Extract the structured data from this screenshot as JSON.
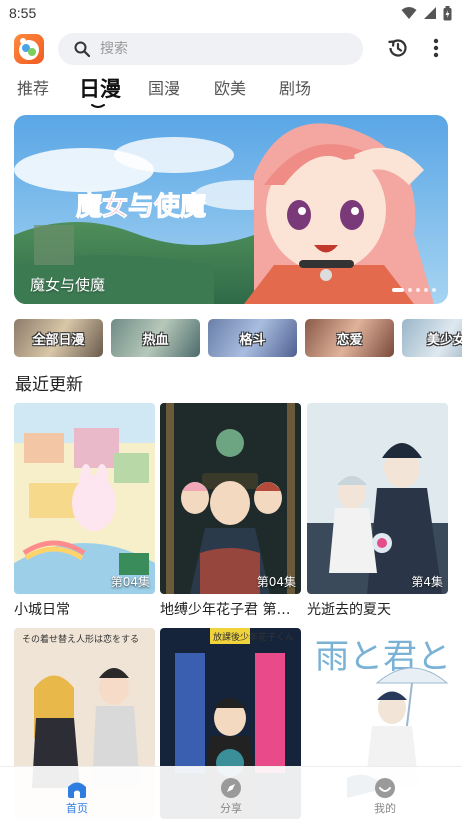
{
  "status_bar": {
    "time": "8:55"
  },
  "search": {
    "placeholder": "搜索"
  },
  "tabs": [
    {
      "label": "推荐",
      "active": false
    },
    {
      "label": "日漫",
      "active": true
    },
    {
      "label": "国漫",
      "active": false
    },
    {
      "label": "欧美",
      "active": false
    },
    {
      "label": "剧场",
      "active": false
    }
  ],
  "banner": {
    "art_text": "魔女与使魔",
    "caption": "魔女与使魔",
    "page_count": 5,
    "active_page": 1
  },
  "genres": [
    {
      "label": "全部日漫"
    },
    {
      "label": "热血"
    },
    {
      "label": "格斗"
    },
    {
      "label": "恋爱"
    },
    {
      "label": "美少女"
    }
  ],
  "section": {
    "title": "最近更新"
  },
  "cards": [
    {
      "title": "小城日常",
      "episode": "第04集"
    },
    {
      "title": "地缚少年花子君 第二季",
      "episode": "第04集"
    },
    {
      "title": "光逝去的夏天",
      "episode": "第4集"
    },
    {
      "title": "",
      "episode": "",
      "cover_text": "その着せ替え人形は恋をする"
    },
    {
      "title": "",
      "episode": "",
      "cover_text": "放課後少年花子くん"
    },
    {
      "title": "",
      "episode": "",
      "cover_text": "雨と君と"
    }
  ],
  "bottom_nav": [
    {
      "label": "首页",
      "active": true,
      "icon": "home-icon"
    },
    {
      "label": "分享",
      "active": false,
      "icon": "compass-icon"
    },
    {
      "label": "我的",
      "active": false,
      "icon": "profile-icon"
    }
  ],
  "colors": {
    "accent": "#2f7de1",
    "tab_active": "#111111",
    "search_bg": "#f0f1f4"
  }
}
